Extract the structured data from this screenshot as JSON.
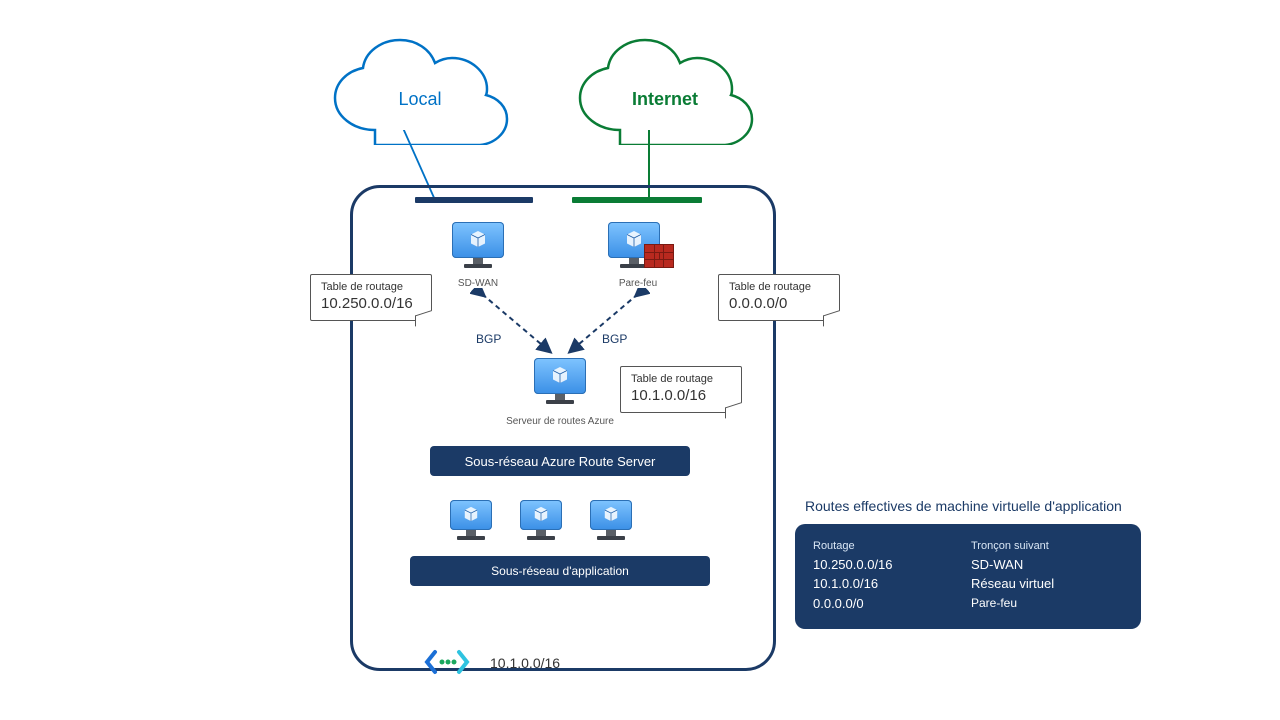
{
  "clouds": {
    "local": "Local",
    "internet": "Internet"
  },
  "bars": {
    "left_color": "#1b3a66",
    "right_color": "#0a7c35"
  },
  "nva": {
    "sdwan": {
      "label": "SD-WAN",
      "note": {
        "title": "Table de routage",
        "value": "10.250.0.0/16"
      }
    },
    "firewall": {
      "label": "Pare-feu",
      "note": {
        "title": "Table de routage",
        "value": "0.0.0.0/0"
      }
    }
  },
  "bgp": {
    "left": "BGP",
    "right": "BGP"
  },
  "route_server": {
    "label": "Serveur de routes Azure",
    "subnet_band": "Sous-réseau Azure Route Server",
    "note": {
      "title": "Table de routage",
      "value": "10.1.0.0/16"
    }
  },
  "app": {
    "subnet_band": "Sous-réseau d'application"
  },
  "vnet": {
    "ip": "10.1.0.0/16"
  },
  "effective": {
    "title": "Routes effectives de machine virtuelle d'application",
    "columns": {
      "route": "Routage",
      "next_hop": "Tronçon suivant"
    },
    "rows": [
      {
        "route": "10.250.0.0/16",
        "next_hop": "SD-WAN"
      },
      {
        "route": "10.1.0.0/16",
        "next_hop": "Réseau virtuel"
      },
      {
        "route": "0.0.0.0/0",
        "next_hop": "Pare-feu"
      }
    ]
  }
}
